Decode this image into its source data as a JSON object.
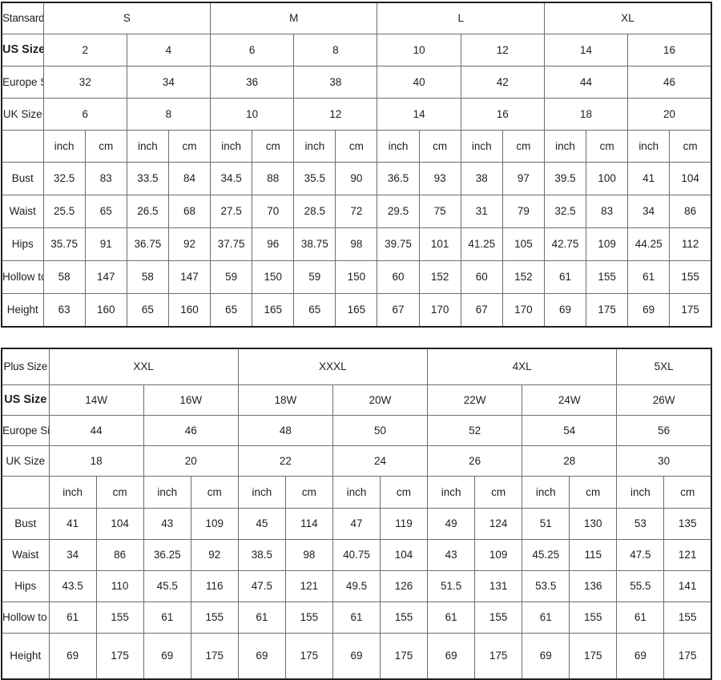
{
  "standard_table": {
    "title_cell": "Stansard Size",
    "size_groups": [
      {
        "label": "S",
        "span": 2
      },
      {
        "label": "M",
        "span": 2
      },
      {
        "label": "L",
        "span": 2
      },
      {
        "label": "XL",
        "span": 2
      }
    ],
    "rows": [
      {
        "label": "US Size",
        "bold": true,
        "values": [
          "2",
          "4",
          "6",
          "8",
          "10",
          "12",
          "14",
          "16"
        ]
      },
      {
        "label": "Europe Size",
        "bold": false,
        "values": [
          "32",
          "34",
          "36",
          "38",
          "40",
          "42",
          "44",
          "46"
        ]
      },
      {
        "label": "UK Size",
        "bold": false,
        "values": [
          "6",
          "8",
          "10",
          "12",
          "14",
          "16",
          "18",
          "20"
        ]
      }
    ],
    "unit_row": {
      "label": "",
      "units": [
        "inch",
        "cm",
        "inch",
        "cm",
        "inch",
        "cm",
        "inch",
        "cm",
        "inch",
        "cm",
        "inch",
        "cm",
        "inch",
        "cm",
        "inch",
        "cm"
      ]
    },
    "measurements": [
      {
        "label": "Bust",
        "values": [
          "32.5",
          "83",
          "33.5",
          "84",
          "34.5",
          "88",
          "35.5",
          "90",
          "36.5",
          "93",
          "38",
          "97",
          "39.5",
          "100",
          "41",
          "104"
        ]
      },
      {
        "label": "Waist",
        "values": [
          "25.5",
          "65",
          "26.5",
          "68",
          "27.5",
          "70",
          "28.5",
          "72",
          "29.5",
          "75",
          "31",
          "79",
          "32.5",
          "83",
          "34",
          "86"
        ]
      },
      {
        "label": "Hips",
        "values": [
          "35.75",
          "91",
          "36.75",
          "92",
          "37.75",
          "96",
          "38.75",
          "98",
          "39.75",
          "101",
          "41.25",
          "105",
          "42.75",
          "109",
          "44.25",
          "112"
        ]
      },
      {
        "label": "Hollow to Hem",
        "values": [
          "58",
          "147",
          "58",
          "147",
          "59",
          "150",
          "59",
          "150",
          "60",
          "152",
          "60",
          "152",
          "61",
          "155",
          "61",
          "155"
        ]
      },
      {
        "label": "Height",
        "values": [
          "63",
          "160",
          "65",
          "160",
          "65",
          "165",
          "65",
          "165",
          "67",
          "170",
          "67",
          "170",
          "69",
          "175",
          "69",
          "175"
        ]
      }
    ]
  },
  "plus_table": {
    "title_cell": "Plus Size",
    "size_groups": [
      {
        "label": "XXL",
        "span": 2
      },
      {
        "label": "XXXL",
        "span": 2
      },
      {
        "label": "4XL",
        "span": 2
      },
      {
        "label": "5XL",
        "span": 1
      }
    ],
    "rows": [
      {
        "label": "US Size",
        "bold": true,
        "values": [
          "14W",
          "16W",
          "18W",
          "20W",
          "22W",
          "24W",
          "26W"
        ]
      },
      {
        "label": "Europe Size",
        "bold": false,
        "values": [
          "44",
          "46",
          "48",
          "50",
          "52",
          "54",
          "56"
        ]
      },
      {
        "label": "UK Size",
        "bold": false,
        "values": [
          "18",
          "20",
          "22",
          "24",
          "26",
          "28",
          "30"
        ]
      }
    ],
    "unit_row": {
      "label": "",
      "units": [
        "inch",
        "cm",
        "inch",
        "cm",
        "inch",
        "cm",
        "inch",
        "cm",
        "inch",
        "cm",
        "inch",
        "cm",
        "inch",
        "cm"
      ]
    },
    "measurements": [
      {
        "label": "Bust",
        "values": [
          "41",
          "104",
          "43",
          "109",
          "45",
          "114",
          "47",
          "119",
          "49",
          "124",
          "51",
          "130",
          "53",
          "135"
        ]
      },
      {
        "label": "Waist",
        "values": [
          "34",
          "86",
          "36.25",
          "92",
          "38.5",
          "98",
          "40.75",
          "104",
          "43",
          "109",
          "45.25",
          "115",
          "47.5",
          "121"
        ]
      },
      {
        "label": "Hips",
        "values": [
          "43.5",
          "110",
          "45.5",
          "116",
          "47.5",
          "121",
          "49.5",
          "126",
          "51.5",
          "131",
          "53.5",
          "136",
          "55.5",
          "141"
        ]
      },
      {
        "label": "Hollow to Hem",
        "values": [
          "61",
          "155",
          "61",
          "155",
          "61",
          "155",
          "61",
          "155",
          "61",
          "155",
          "61",
          "155",
          "61",
          "155"
        ]
      },
      {
        "label": "Height",
        "values": [
          "69",
          "175",
          "69",
          "175",
          "69",
          "175",
          "69",
          "175",
          "69",
          "175",
          "69",
          "175",
          "69",
          "175"
        ]
      }
    ]
  }
}
